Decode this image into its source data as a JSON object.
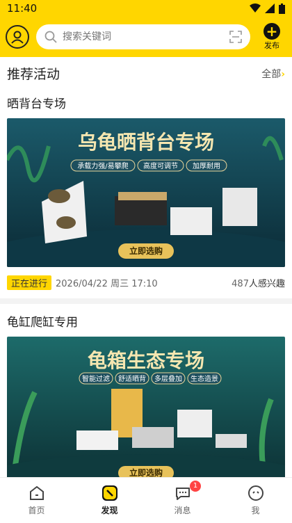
{
  "status": {
    "time": "11:40"
  },
  "header": {
    "search_placeholder": "搜索关键词",
    "publish_label": "发布"
  },
  "section": {
    "title": "推荐活动",
    "more": "全部"
  },
  "activities": [
    {
      "title": "晒背台专场",
      "banner_title": "乌龟晒背台专场",
      "banner_tags": [
        "承载力强/易攀爬",
        "高度可调节",
        "加厚耐用"
      ],
      "banner_cta": "立即选购",
      "badge": "正在进行",
      "date": "2026/04/22 周三 17:10",
      "interest_count": "487",
      "interest_suffix": "人感兴趣"
    },
    {
      "title": "龟缸爬缸专用",
      "banner_title": "龟箱生态专场",
      "banner_tags": [
        "智能过滤",
        "舒适晒背",
        "多层叠加",
        "生态造景"
      ],
      "banner_cta": "立即选购"
    }
  ],
  "nav": {
    "items": [
      {
        "label": "首页"
      },
      {
        "label": "发现"
      },
      {
        "label": "消息",
        "badge": "1"
      },
      {
        "label": "我"
      }
    ]
  }
}
